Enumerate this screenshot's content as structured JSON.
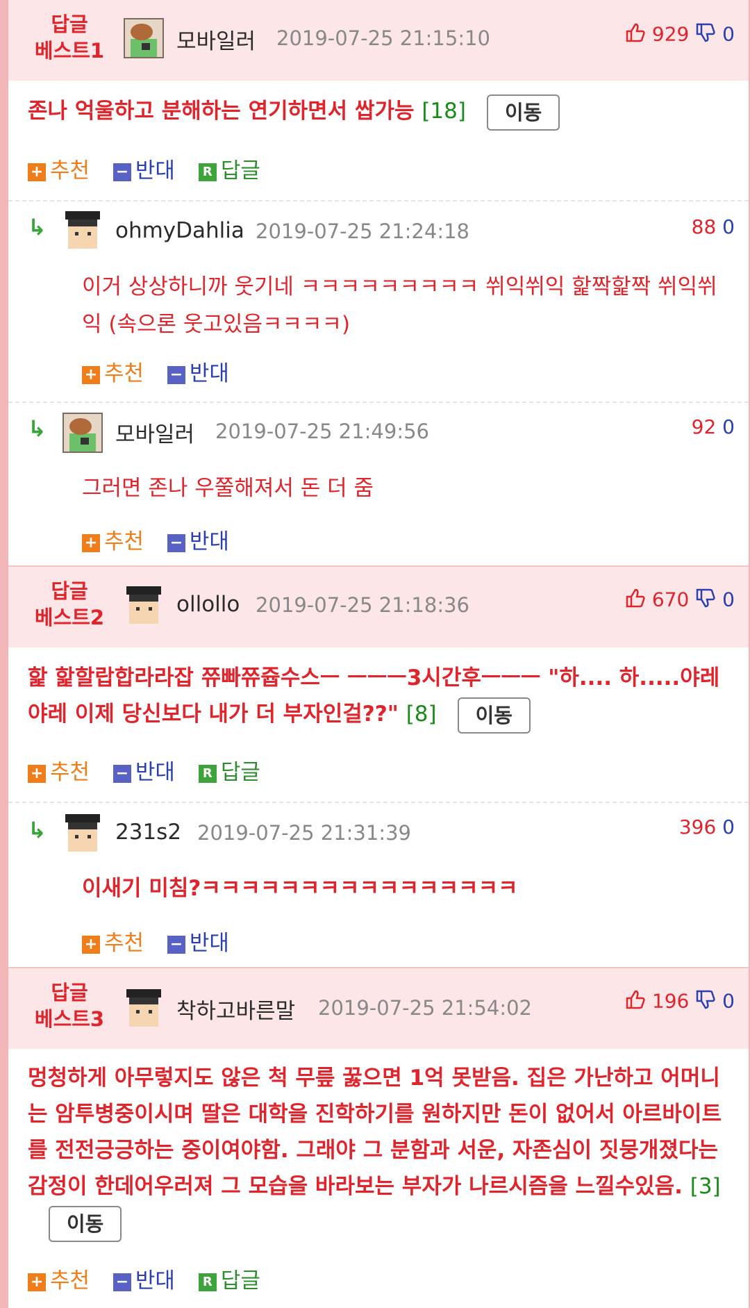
{
  "best": [
    {
      "label": "답글\n베스트1",
      "user": "모바일러",
      "date": "2019-07-25 21:15:10",
      "up": "929",
      "down": "0",
      "text": "존나 억울하고 분해하는 연기하면서 쌉가능",
      "count": "[18]",
      "move": "이동",
      "actions": {
        "recommend": "추천",
        "oppose": "반대",
        "reply": "답글"
      },
      "replies": [
        {
          "user": "ohmyDahlia",
          "date": "2019-07-25 21:24:18",
          "up": "88",
          "down": "0",
          "text": "이거 상상하니까 웃기네 ㅋㅋㅋㅋㅋㅋㅋㅋㅋ 쒸익쒸익 핥짝핥짝 쒸익쒸익 (속으론 웃고있음ㅋㅋㅋㅋ)"
        },
        {
          "user": "모바일러",
          "date": "2019-07-25 21:49:56",
          "up": "92",
          "down": "0",
          "text": "그러면 존나 우쭐해져서 돈 더 줌"
        }
      ]
    },
    {
      "label": "답글\n베스트2",
      "user": "ollollo",
      "date": "2019-07-25 21:18:36",
      "up": "670",
      "down": "0",
      "text": "핥 핥할랍합라라잡 쮸빠쮸쥽수스ㅡ ㅡㅡㅡ3시간후ㅡㅡㅡ \"하.... 하.....야레야레 이제 당신보다 내가 더 부자인걸??\"",
      "count": "[8]",
      "move": "이동",
      "actions": {
        "recommend": "추천",
        "oppose": "반대",
        "reply": "답글"
      },
      "replies": [
        {
          "user": "231s2",
          "date": "2019-07-25 21:31:39",
          "up": "396",
          "down": "0",
          "text": "이새기 미침?ㅋㅋㅋㅋㅋㅋㅋㅋㅋㅋㅋㅋㅋㅋㅋㅋ"
        }
      ]
    },
    {
      "label": "답글\n베스트3",
      "user": "착하고바른말",
      "date": "2019-07-25 21:54:02",
      "up": "196",
      "down": "0",
      "text": "멍청하게 아무렇지도 않은 척 무릎 꿇으면 1억 못받음. 집은 가난하고 어머니는 암투병중이시며 딸은 대학을 진학하기를 원하지만 돈이 없어서 아르바이트를 전전긍긍하는 중이여야함. 그래야 그 분함과 서운, 자존심이 짓뭉개졌다는 감정이 한데어우러져 그 모습을 바라보는 부자가 나르시즘을 느낄수있음.",
      "count": "[3]",
      "move": "이동",
      "actions": {
        "recommend": "추천",
        "oppose": "반대",
        "reply": "답글"
      },
      "replies": []
    }
  ],
  "reply_actions": {
    "recommend": "추천",
    "oppose": "반대"
  }
}
